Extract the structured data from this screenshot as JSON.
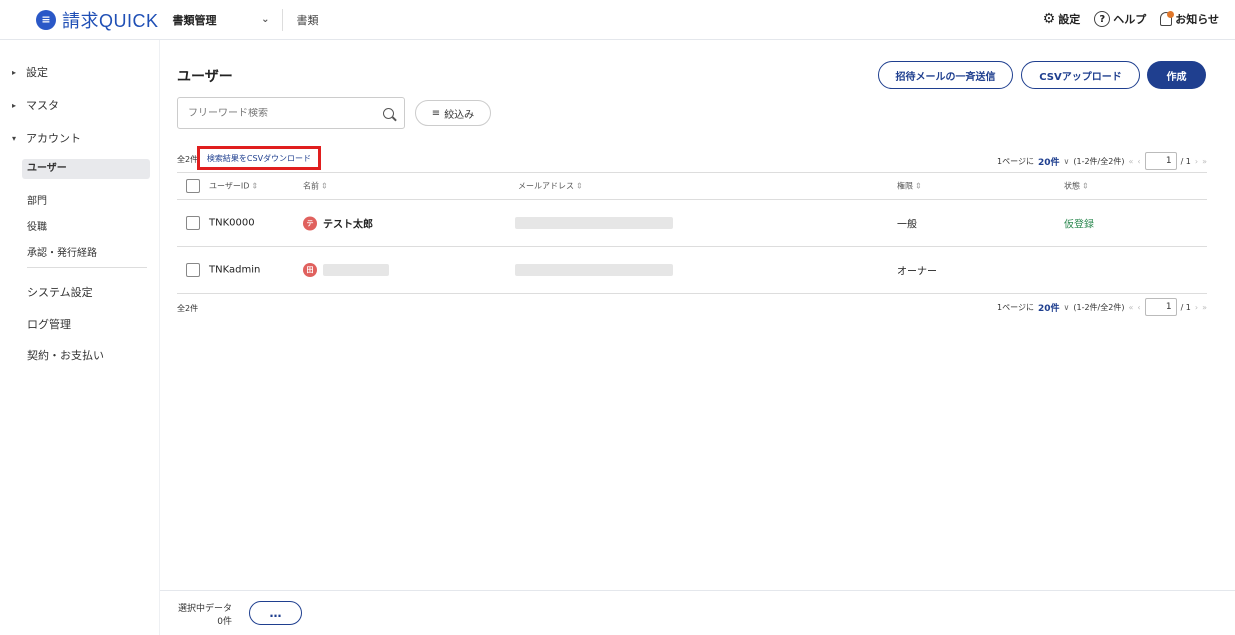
{
  "header": {
    "logo_icon": "document-icon",
    "app_name": "請求QUICK",
    "product": "書類管理",
    "nav": "書類",
    "settings": "設定",
    "help": "ヘルプ",
    "notifications": "お知らせ"
  },
  "sidebar": {
    "sections": [
      {
        "label": "設定",
        "expanded": false
      },
      {
        "label": "マスタ",
        "expanded": false
      },
      {
        "label": "アカウント",
        "expanded": true
      }
    ],
    "account_items": [
      {
        "label": "ユーザー",
        "active": true
      },
      {
        "label": "部門",
        "active": false
      },
      {
        "label": "役職",
        "active": false
      },
      {
        "label": "承認・発行経路",
        "active": false
      }
    ],
    "other_items": [
      "システム設定",
      "ログ管理",
      "契約・お支払い"
    ]
  },
  "main": {
    "title": "ユーザー",
    "buttons": {
      "invite": "招待メールの一斉送信",
      "csv_upload": "CSVアップロード",
      "create": "作成"
    },
    "search": {
      "placeholder": "フリーワード検索"
    },
    "filter": "絞込み",
    "total": "全2件",
    "csv_download": "検索結果をCSVダウンロード",
    "pager": {
      "per_label": "1ページに",
      "per_value": "20件",
      "range": "(1-2件/全2件)",
      "page": "1",
      "of": "/ 1"
    },
    "columns": {
      "id": "ユーザーID",
      "name": "名前",
      "email": "メールアドレス",
      "role": "権限",
      "status": "状態"
    },
    "rows": [
      {
        "id": "TNK0000",
        "avatar": "テ",
        "name": "テスト太郎",
        "role": "一般",
        "status": "仮登録"
      },
      {
        "id": "TNKadmin",
        "avatar": "田",
        "name": "",
        "role": "オーナー",
        "status": ""
      }
    ]
  },
  "footer": {
    "selected_label": "選択中データ",
    "selected_count": "0件",
    "more": "…"
  },
  "colors": {
    "brand": "#1f3f8f",
    "highlight": "#e01e1e",
    "status_green": "#2e8a52",
    "avatar": "#e0615e"
  }
}
